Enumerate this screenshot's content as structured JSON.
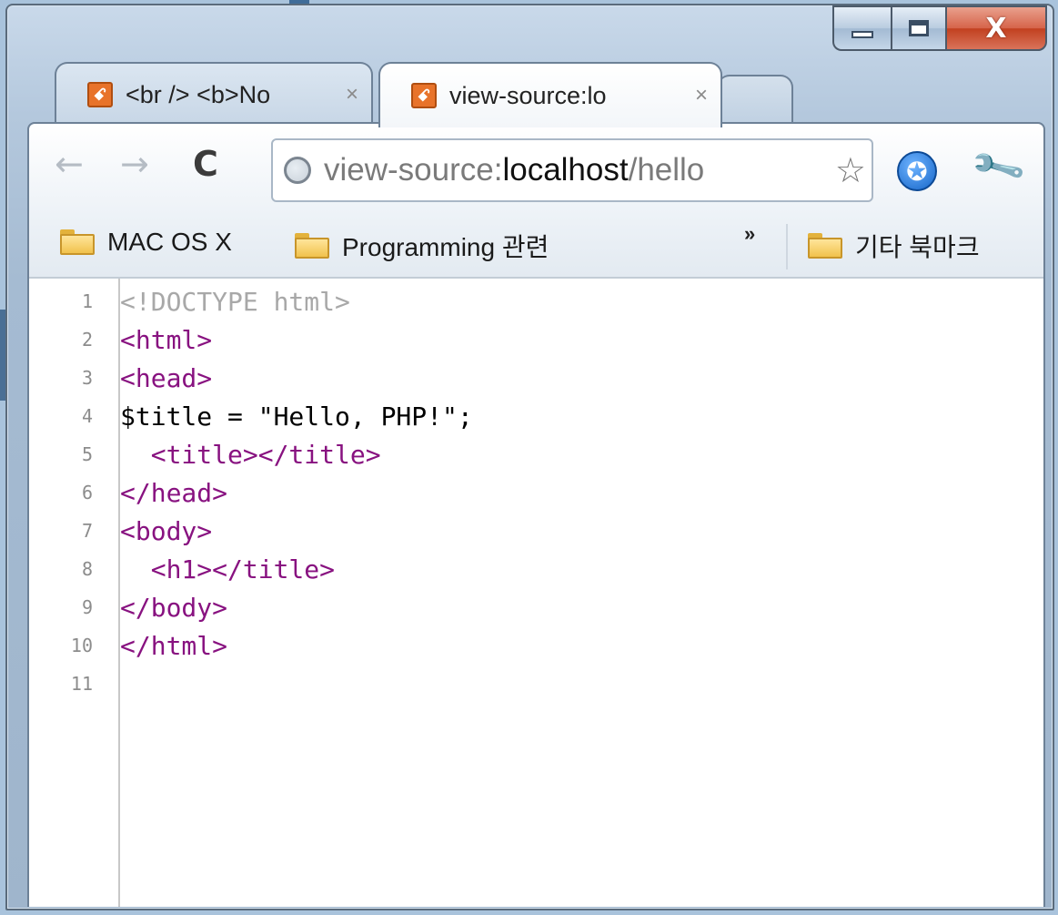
{
  "window": {
    "controls": {
      "minimize_icon": "minimize-icon",
      "maximize_icon": "maximize-icon",
      "close_glyph": "X"
    }
  },
  "tabs": [
    {
      "title": "<br /> <b>No",
      "close": "×",
      "favicon": "xampp-favicon",
      "active": false
    },
    {
      "title": "view-source:lo",
      "close": "×",
      "favicon": "xampp-favicon",
      "active": true
    }
  ],
  "toolbar": {
    "back_icon": "←",
    "forward_icon": "→",
    "reload_icon": "C",
    "url_scheme": "view-source:",
    "url_host": "localhost",
    "url_path": "/hello",
    "star_icon": "☆",
    "extension_icon": "✪",
    "wrench_icon": "🔧"
  },
  "bookmarks": {
    "items": [
      "MAC OS X",
      "Programming 관련"
    ],
    "overflow": "»",
    "other": "기타 북마크"
  },
  "source": {
    "lines": [
      {
        "num": "1",
        "text": "<!DOCTYPE html>",
        "kind": "doctype"
      },
      {
        "num": "2",
        "text": "<html>",
        "kind": "tag"
      },
      {
        "num": "3",
        "text": "<head>",
        "kind": "tag"
      },
      {
        "num": "4",
        "text": "$title = \"Hello, PHP!\";",
        "kind": "text"
      },
      {
        "num": "5",
        "text": "  <title></title>",
        "kind": "tag"
      },
      {
        "num": "6",
        "text": "</head>",
        "kind": "tag"
      },
      {
        "num": "7",
        "text": "<body>",
        "kind": "tag"
      },
      {
        "num": "8",
        "text": "  <h1></title>",
        "kind": "tag"
      },
      {
        "num": "9",
        "text": "</body>",
        "kind": "tag"
      },
      {
        "num": "10",
        "text": "</html>",
        "kind": "tag"
      },
      {
        "num": "11",
        "text": "",
        "kind": "text"
      }
    ]
  },
  "colors": {
    "tag": "#881280",
    "doctype": "#a8a8a8",
    "text": "#000000",
    "favicon": "#e8732a",
    "close_button": "#c2401f"
  }
}
